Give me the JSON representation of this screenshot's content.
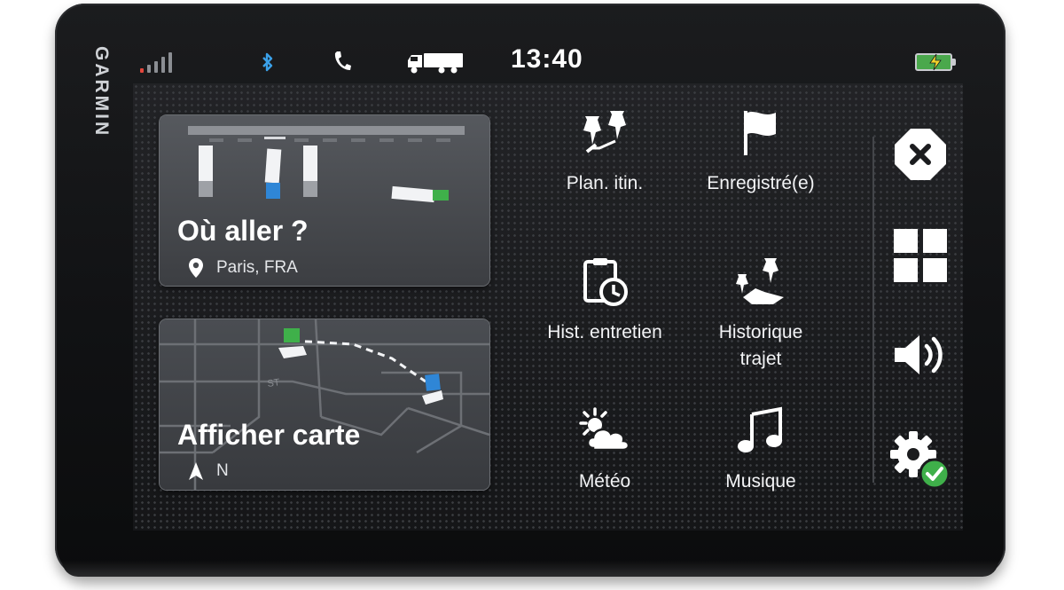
{
  "device": {
    "brand": "GARMIN"
  },
  "status_bar": {
    "time": "13:40",
    "icons": [
      "signal-icon",
      "bluetooth-icon",
      "phone-icon",
      "truck-icon",
      "battery-charging-icon"
    ],
    "colors": {
      "bluetooth": "#3aa0e8",
      "signal_active": "#e3473d",
      "battery_fill": "#4aa84c"
    }
  },
  "cards": {
    "where_to": {
      "title": "Où aller ?",
      "location": "Paris, FRA",
      "icon": "location-pin-icon"
    },
    "view_map": {
      "title": "Afficher carte",
      "heading": "N",
      "icon": "north-arrow-icon"
    }
  },
  "menu": {
    "route_planner": {
      "label": "Plan. itin.",
      "icon": "route-planner-icon"
    },
    "saved": {
      "label": "Enregistré(e)",
      "icon": "flag-icon"
    },
    "maintenance_history": {
      "label": "Hist. entretien",
      "icon": "clipboard-clock-icon"
    },
    "trip_history_line1": "Historique",
    "trip_history_line2": "trajet",
    "weather": {
      "label": "Météo",
      "icon": "weather-icon"
    },
    "music": {
      "label": "Musique",
      "icon": "music-note-icon"
    }
  },
  "side_buttons": [
    "close-icon",
    "apps-grid-icon",
    "volume-icon",
    "settings-check-icon"
  ],
  "accent_colors": {
    "route_green": "#3fb04a",
    "destination_blue": "#2f86d6",
    "settings_check": "#3fb04a"
  }
}
